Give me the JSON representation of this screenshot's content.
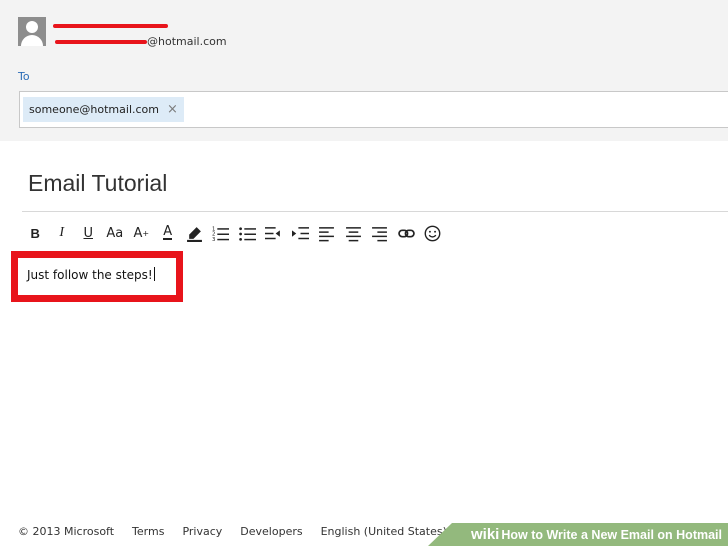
{
  "header": {
    "sender_email_suffix": "@hotmail.com"
  },
  "to": {
    "label": "To",
    "recipient": "someone@hotmail.com",
    "remove_glyph": "×"
  },
  "compose": {
    "subject": "Email Tutorial",
    "body": "Just follow the steps!"
  },
  "toolbar": {
    "bold": "B",
    "italic": "I",
    "underline": "U",
    "font_size": "Aa",
    "grow_font": "A",
    "font_color": "A"
  },
  "footer": {
    "copyright": "© 2013 Microsoft",
    "terms": "Terms",
    "privacy": "Privacy",
    "developers": "Developers",
    "language": "English (United States)"
  },
  "banner": {
    "wiki": "wiki",
    "title": "How to Write a New Email on Hotmail"
  },
  "colors": {
    "highlight": "#e8141b",
    "link_blue": "#2b6cb7",
    "chip_bg": "#ddebf7",
    "banner_green": "#93b97d"
  }
}
